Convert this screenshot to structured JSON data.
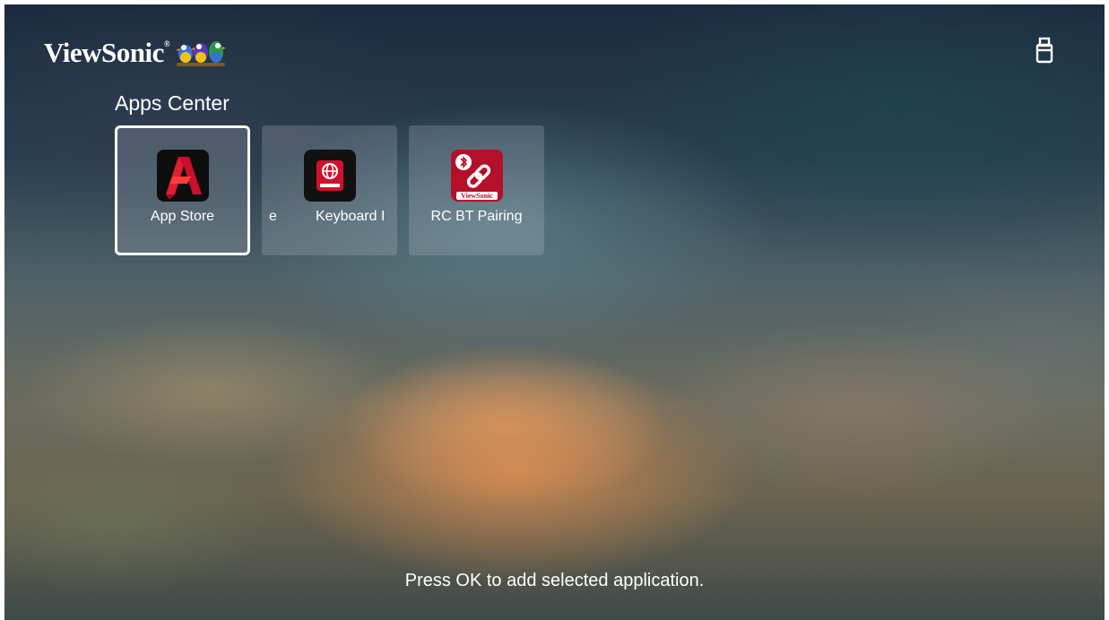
{
  "brand": {
    "name": "ViewSonic",
    "reg_mark": "®"
  },
  "status": {
    "usb_icon": "usb-storage-icon"
  },
  "section": {
    "title": "Apps Center"
  },
  "apps": [
    {
      "label": "App Store",
      "icon": "app-store-icon",
      "selected": true
    },
    {
      "label_fragment_left": "e",
      "label": "Keyboard I",
      "icon": "keyboard-icon",
      "selected": false
    },
    {
      "label": "RC BT Pairing",
      "icon": "rc-bt-pairing-icon",
      "icon_text": "ViewSonic",
      "selected": false
    }
  ],
  "hint": "Press OK to add selected application.",
  "colors": {
    "selection_border": "#ffffff",
    "app_icon_red": "#c8102e",
    "text": "#ffffff"
  }
}
